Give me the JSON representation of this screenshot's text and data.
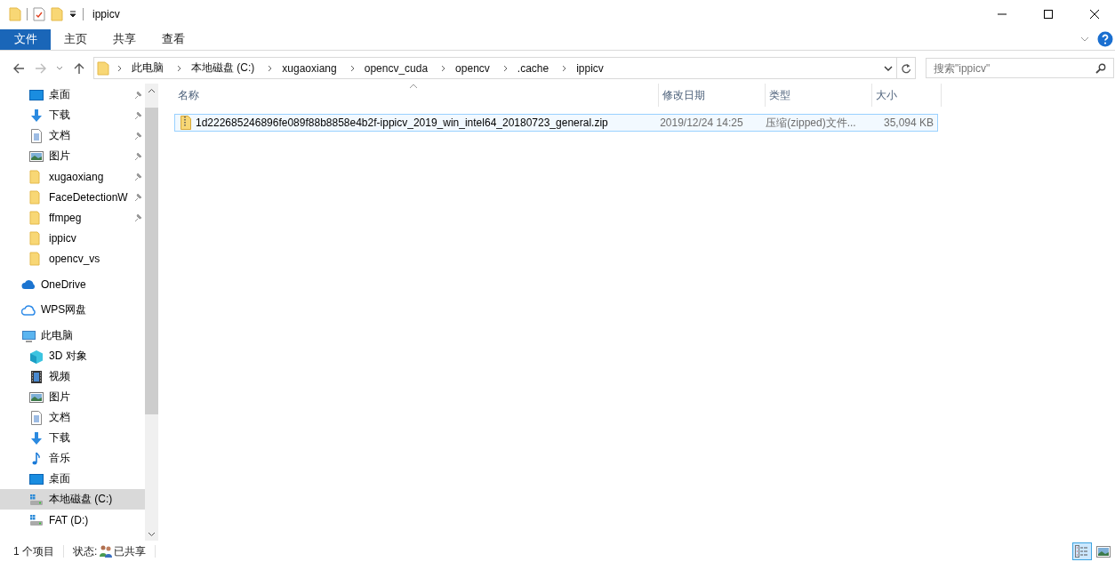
{
  "window": {
    "title": "ippicv"
  },
  "ribbon": {
    "tabs": [
      {
        "label": "文件",
        "selected": true
      },
      {
        "label": "主页",
        "selected": false
      },
      {
        "label": "共享",
        "selected": false
      },
      {
        "label": "查看",
        "selected": false
      }
    ]
  },
  "address": {
    "crumbs": [
      "此电脑",
      "本地磁盘 (C:)",
      "xugaoxiang",
      "opencv_cuda",
      "opencv",
      ".cache",
      "ippicv"
    ]
  },
  "search": {
    "placeholder": "搜索\"ippicv\""
  },
  "nav": {
    "quick_access": [
      {
        "label": "桌面",
        "kind": "desktop",
        "pinned": true
      },
      {
        "label": "下载",
        "kind": "download",
        "pinned": true
      },
      {
        "label": "文档",
        "kind": "document",
        "pinned": true
      },
      {
        "label": "图片",
        "kind": "picture",
        "pinned": true
      },
      {
        "label": "xugaoxiang",
        "kind": "folder",
        "pinned": true
      },
      {
        "label": "FaceDetectionW",
        "kind": "folder",
        "pinned": true
      },
      {
        "label": "ffmpeg",
        "kind": "folder",
        "pinned": true
      },
      {
        "label": "ippicv",
        "kind": "folder",
        "pinned": false
      },
      {
        "label": "opencv_vs",
        "kind": "folder",
        "pinned": false
      }
    ],
    "roots": [
      {
        "label": "OneDrive",
        "kind": "cloud",
        "selected": false
      },
      {
        "label": "WPS网盘",
        "kind": "cloud-outline",
        "selected": false
      },
      {
        "label": "此电脑",
        "kind": "pc",
        "selected": false,
        "children": [
          {
            "label": "3D 对象",
            "kind": "cube",
            "selected": false
          },
          {
            "label": "视频",
            "kind": "video",
            "selected": false
          },
          {
            "label": "图片",
            "kind": "picture",
            "selected": false
          },
          {
            "label": "文档",
            "kind": "document",
            "selected": false
          },
          {
            "label": "下载",
            "kind": "download",
            "selected": false
          },
          {
            "label": "音乐",
            "kind": "music",
            "selected": false
          },
          {
            "label": "桌面",
            "kind": "desktop",
            "selected": false
          },
          {
            "label": "本地磁盘 (C:)",
            "kind": "drive",
            "selected": true
          },
          {
            "label": "FAT (D:)",
            "kind": "drive",
            "selected": false
          }
        ]
      }
    ]
  },
  "table": {
    "columns": [
      "名称",
      "修改日期",
      "类型",
      "大小"
    ],
    "rows": [
      {
        "name": "1d222685246896fe089f88b8858e4b2f-ippicv_2019_win_intel64_20180723_general.zip",
        "modified": "2019/12/24 14:25",
        "type": "压缩(zipped)文件...",
        "size": "35,094 KB",
        "selected": false,
        "hovered": true
      }
    ]
  },
  "status_bar": {
    "count": "1 个项目",
    "state_label": "状态:",
    "state": "已共享"
  },
  "view": {
    "details_selected": true
  }
}
